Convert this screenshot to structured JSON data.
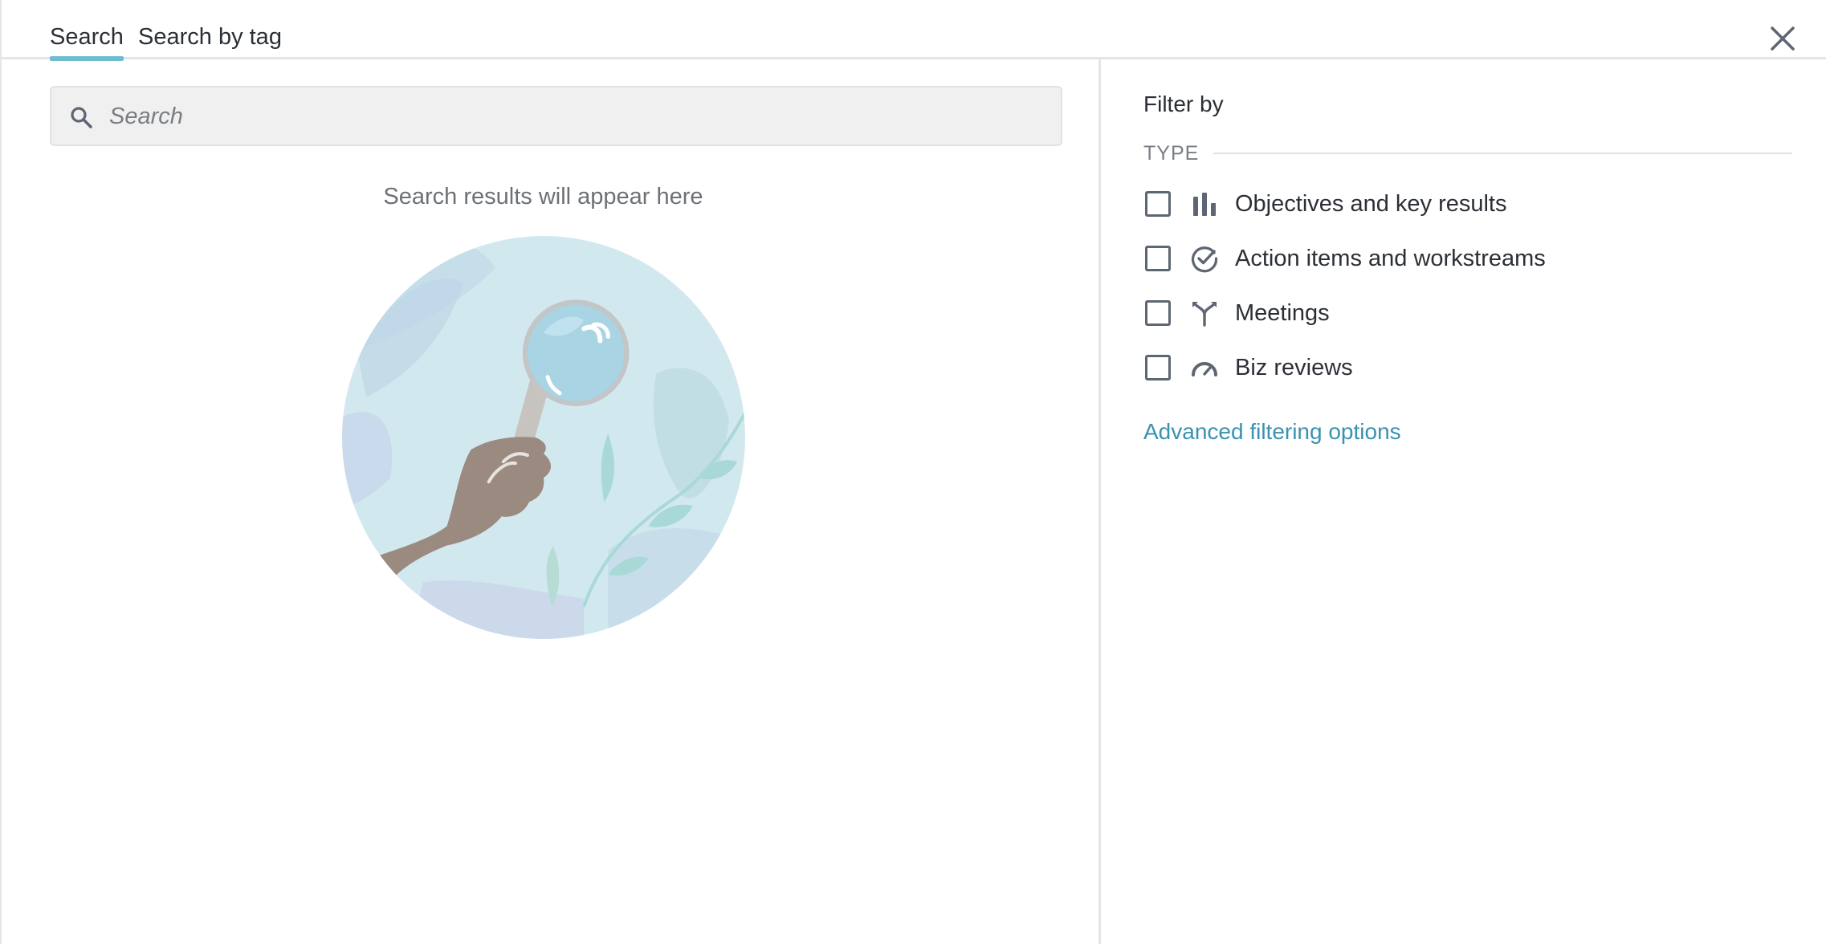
{
  "tabs": [
    {
      "label": "Search",
      "active": true
    },
    {
      "label": "Search by tag",
      "active": false
    }
  ],
  "search": {
    "placeholder": "Search",
    "value": ""
  },
  "results": {
    "empty_message": "Search results will appear here"
  },
  "filters": {
    "title": "Filter by",
    "section_label": "TYPE",
    "options": [
      {
        "label": "Objectives and key results",
        "icon": "bar-chart-icon",
        "checked": false
      },
      {
        "label": "Action items and workstreams",
        "icon": "check-circle-icon",
        "checked": false
      },
      {
        "label": "Meetings",
        "icon": "merge-arrows-icon",
        "checked": false
      },
      {
        "label": "Biz reviews",
        "icon": "gauge-icon",
        "checked": false
      }
    ],
    "advanced_link": "Advanced filtering options"
  },
  "colors": {
    "accent": "#6fbcd1",
    "link": "#3a92b0",
    "icon": "#5d6672"
  }
}
